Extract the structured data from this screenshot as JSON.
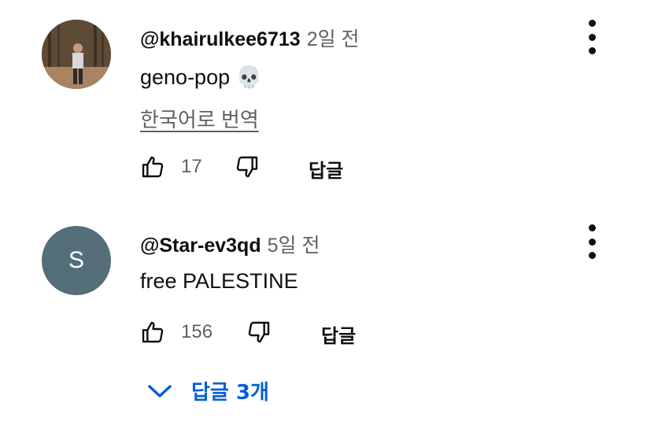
{
  "comments": [
    {
      "handle": "@khairulkee6713",
      "time": "2일 전",
      "text": "geno-pop",
      "emoji": "💀",
      "translate_label": "한국어로 번역",
      "likes": "17",
      "reply_label": "답글",
      "avatar_type": "photo"
    },
    {
      "handle": "@Star-ev3qd",
      "time": "5일 전",
      "text": "free PALESTINE",
      "likes": "156",
      "reply_label": "답글",
      "avatar_letter": "S",
      "avatar_color": "#546e7a"
    }
  ],
  "replies_toggle": {
    "label": "답글 3개",
    "color": "#065fd4",
    "icon": "chevron-down-icon"
  },
  "icons": {
    "like": "thumb-up-icon",
    "dislike": "thumb-down-icon",
    "menu": "more-vert-icon"
  }
}
